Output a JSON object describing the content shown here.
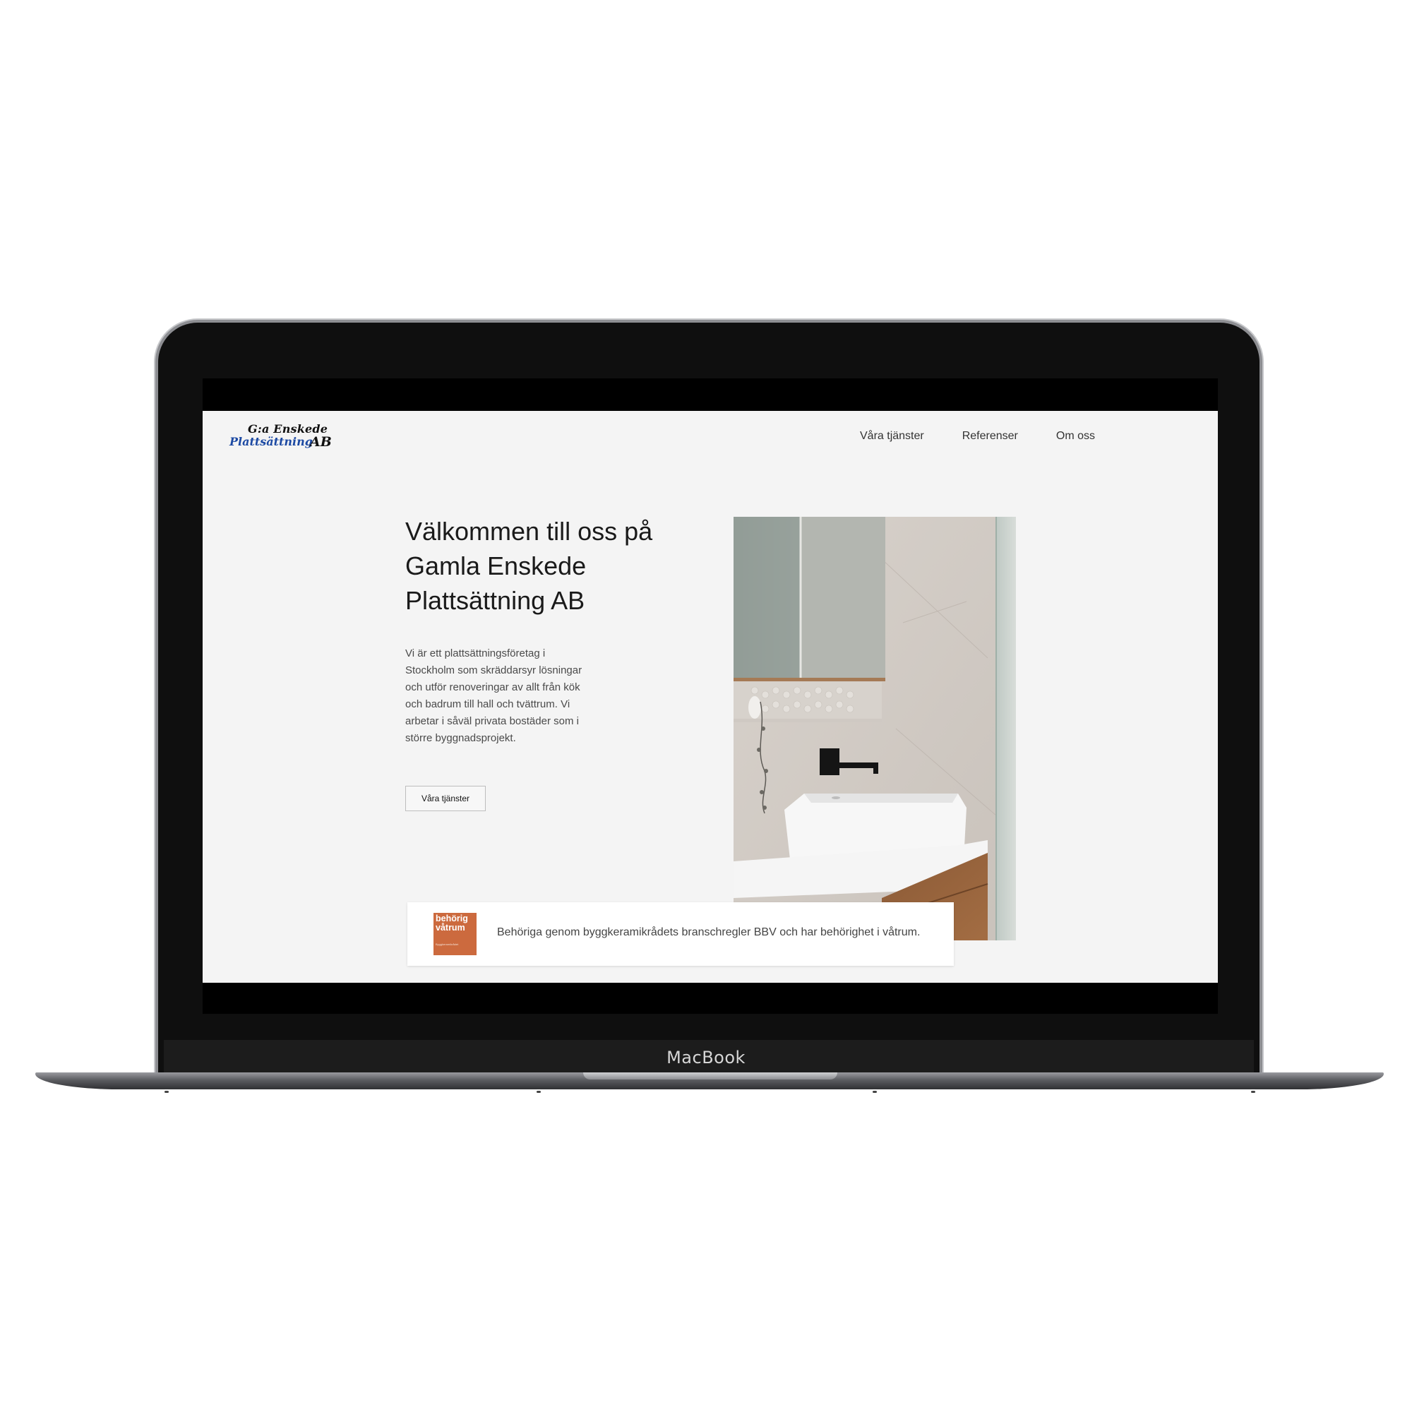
{
  "device": {
    "label": "MacBook"
  },
  "header": {
    "logo": {
      "line1": "G:a Enskede",
      "line2": "Plattsättning",
      "line3": "AB"
    },
    "nav": [
      {
        "label": "Våra tjänster"
      },
      {
        "label": "Referenser"
      },
      {
        "label": "Om oss"
      }
    ]
  },
  "hero": {
    "title": "Välkommen till oss på Gamla Enskede Plattsättning AB",
    "text": "Vi är ett plattsättningsföretag i Stockholm som skräddarsyr lösningar och utför renoveringar av allt från kök och badrum till hall och tvättrum. Vi arbetar i såväl privata bostäder som i större byggnadsprojekt.",
    "button_label": "Våra tjänster"
  },
  "certification": {
    "badge": {
      "line1": "behörig",
      "line2": "våtrum",
      "fine_print": "Byggkeramikrådet"
    },
    "text": "Behöriga genom byggkeramikrådets branschregler BBV och har behörighet i våtrum."
  },
  "colors": {
    "page_bg": "#f4f4f4",
    "badge": "#cc6a3e",
    "logo_blue": "#1d4aa3"
  }
}
